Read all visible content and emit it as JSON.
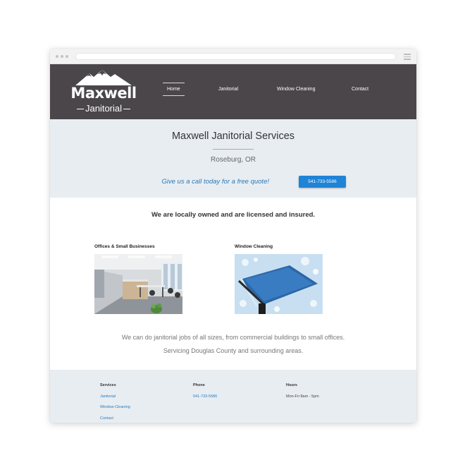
{
  "site": {
    "logo": {
      "name": "Maxwell",
      "subtitle": "Janitorial"
    },
    "nav": [
      {
        "label": "Home"
      },
      {
        "label": "Janitorial"
      },
      {
        "label": "Window Cleaning"
      },
      {
        "label": "Contact"
      }
    ]
  },
  "hero": {
    "title": "Maxwell Janitorial Services",
    "city": "Roseburg, OR",
    "cta_text": "Give us a call today for a free quote!",
    "phone_button": "541-733-5586"
  },
  "main": {
    "tagline": "We are locally owned and are licensed and insured.",
    "services": [
      {
        "label": "Offices & Small Businesses"
      },
      {
        "label": "Window Cleaning"
      }
    ],
    "description_lines": [
      "We can do janitorial jobs of all sizes, from commercial buildings to small offices.",
      "Servicing Douglas County and surrounding areas."
    ]
  },
  "footer": {
    "services_heading": "Services",
    "services_links": [
      "Janitorial",
      "Window Cleaning",
      "Contact"
    ],
    "phone_heading": "Phone",
    "phone_value": "541-733-5586",
    "hours_heading": "Hours",
    "hours_value": "Mon-Fri 8am - 5pm"
  },
  "colors": {
    "header_bg": "#4a4649",
    "hero_bg": "#e8edf2",
    "accent_blue": "#1f83d6",
    "link_blue": "#2a7ab8"
  },
  "icons": [
    "mountain-logo-icon",
    "hamburger-menu-icon"
  ]
}
